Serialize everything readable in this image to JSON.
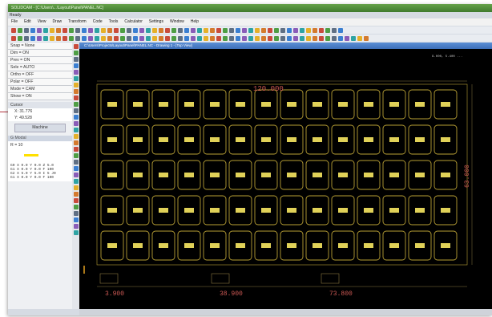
{
  "app": {
    "title": "SOLIDCAM - [C:\\Users\\...\\Layout\\Panel\\PANEL.NC]",
    "status": "Ready"
  },
  "menu": [
    "File",
    "Edit",
    "View",
    "Draw",
    "Transform",
    "Code",
    "Tools",
    "Calculator",
    "Settings",
    "Window",
    "Help"
  ],
  "left_panel": {
    "options": [
      "Snap = None",
      "Dim = ON",
      "Prev = ON",
      "Sele = AUTO",
      "Ortho = OFF",
      "Polar = OFF",
      "Mode = CAM",
      "Show = ON"
    ],
    "cursor_label": "Cursor",
    "cursor_x_label": "X:",
    "cursor_x": "31.776",
    "cursor_y_label": "Y:",
    "cursor_y": "49.528",
    "machine_button": "Machine",
    "section_label": "G Modal",
    "radius": "R = 10",
    "nc_lines": [
      "G0 X 0.0 Y 0.0 Z 5.0",
      "G1 X 0.0 Y 0.0 F 100",
      "G2 X 5.0 Y 5.0 I 5 J0",
      "G1 X 0.0 Y 0.0 F 100"
    ]
  },
  "document": {
    "title": "C:\\Users\\Projects\\Layout\\Panel\\PANEL.NC - Drawing 1 - [Top View]"
  },
  "canvas": {
    "background": "#000000",
    "outline_color": "#b8a035",
    "grid_columns": 14,
    "grid_rows": 5,
    "dim_top": "120.000",
    "dim_right": "63.000",
    "dim_bottom_1": "3.900",
    "dim_bottom_2": "38.900",
    "dim_bottom_3": "73.800",
    "readout": "9.000, 5.400 ..."
  },
  "colors": {
    "pad_outline": "#b8a035",
    "pad_fill": "#e0d158",
    "dimension_text": "#cf5a55",
    "legend_line": "#ffe000"
  }
}
